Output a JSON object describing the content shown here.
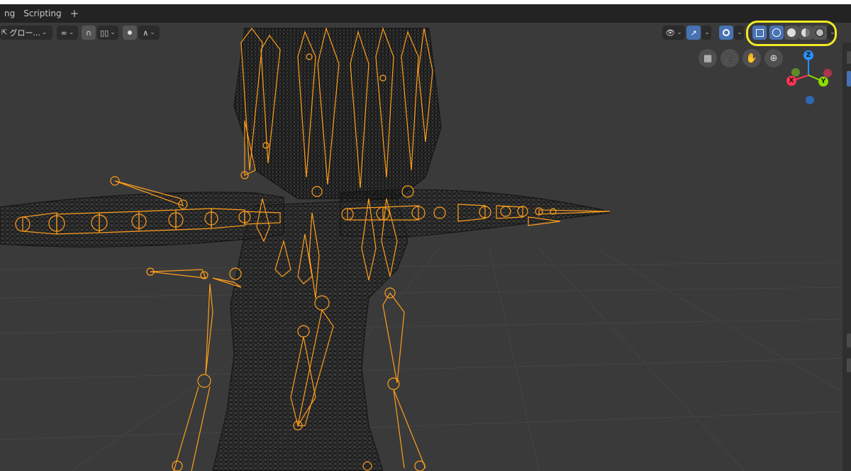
{
  "tabs": [
    {
      "label": "ng",
      "active": false
    },
    {
      "label": "Scripting",
      "active": false
    }
  ],
  "add_tab_label": "+",
  "header": {
    "transform_orientation": "グロー..."
  },
  "gizmo": {
    "z_label": "Z",
    "x_label": "X",
    "y_label": "Y"
  },
  "colors": {
    "armature": "#ff9e1a",
    "wire": "#111111",
    "viewport_bg": "#3a3a3a",
    "highlight": "#f2ea24",
    "active_button": "#4772b3",
    "axis_x": "#ff3352",
    "axis_y": "#8bdc00",
    "axis_z": "#2890ff"
  },
  "shading_modes": [
    "wireframe",
    "solid",
    "material-preview",
    "rendered"
  ],
  "active_shading": "wireframe"
}
